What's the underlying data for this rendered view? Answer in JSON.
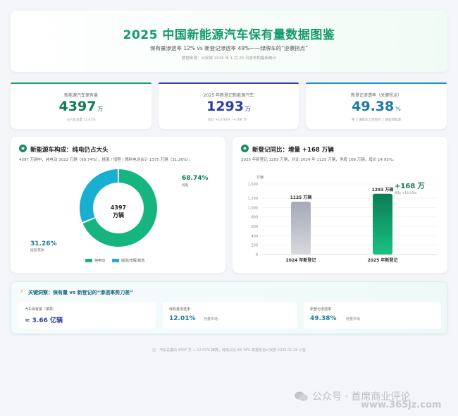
{
  "header": {
    "title": "2025 中国新能源汽车保有量数据图鉴",
    "subtitle": "保有量渗透率 12% vs 新登记渗透率 49%——绿牌车的“逆袭拐点”",
    "source": "数据来源：公安部 2026 年 1 月 26 日发布的最新统计"
  },
  "kpis": [
    {
      "label": "新能源汽车保有量",
      "value": "4397",
      "unit": "万",
      "note": "占汽车总量 12.01%"
    },
    {
      "label": "2025 年新登记新能源汽车",
      "value": "1293",
      "unit": "万",
      "note": "同比 +14.93%（+168 万）"
    },
    {
      "label": "新登记渗透率（关键拐点）",
      "value": "49.38",
      "unit": "%",
      "note": "每 2 辆新车上牌就有 1 辆是新能源"
    }
  ],
  "panel_left": {
    "title": "新能源车构成：纯电仍占大头",
    "desc": "4397 万辆中，纯电动 3022 万辆（68.74%），插混 / 增程 / 燃料电池合计 1375 万辆（31.26%）。",
    "center_line1": "4397",
    "center_line2": "万辆",
    "bev_pct": "68.74%",
    "bev_sub": "纯电",
    "phev_pct": "31.26%",
    "phev_sub": "插混/其他",
    "legend_bev": "纯电动",
    "legend_phev": "插混/增程/其他"
  },
  "panel_right": {
    "title": "新登记同比：增量 +168 万辆",
    "desc": "2025 年新登记 1293 万辆，对比 2024 年 1125 万辆，净增 168 万辆，增长 14.93%。",
    "delta_label": "+168 万",
    "delta_sub": "同比 +14.93%"
  },
  "chart_data": [
    {
      "type": "pie",
      "categories": [
        "纯电动",
        "插混/增程/其他"
      ],
      "values": [
        68.74,
        31.26
      ],
      "colors": [
        "#16b57f",
        "#1aaed0"
      ],
      "total_label": "4397 万辆"
    },
    {
      "type": "bar",
      "categories": [
        "2024 年新登记",
        "2025 年新登记"
      ],
      "values": [
        1125,
        1293
      ],
      "data_labels": [
        "1125 万辆",
        "1293 万辆"
      ],
      "ylabel": "万辆",
      "ylim": [
        0,
        1500
      ],
      "yticks": [
        0,
        200,
        400,
        600,
        800,
        1000,
        1200,
        1500
      ],
      "ytick_labels": [
        "0",
        "200",
        "400",
        "600",
        "800",
        "1,000",
        "1,200",
        "1,500"
      ],
      "colors": [
        "#a9adb8",
        "#0f8f61"
      ],
      "grid": true
    }
  ],
  "insight": {
    "title": "关键洞察：保有量 vs 新登记的“渗透率剪刀差”",
    "items": [
      {
        "label": "汽车保有量（推算）",
        "value": "≈ 3.66 亿辆",
        "extra": ""
      },
      {
        "label": "保有量渗透率",
        "value": "12.01%",
        "extra": "存量市场"
      },
      {
        "label": "新登记渗透率",
        "value": "49.38%",
        "extra": "增量市场"
      }
    ]
  },
  "footnote": "注：汽车总量由 4397 万 ÷ 12.01% 推算；纯电占比 68.74% 数据来自公安部 2026.01.26 公告",
  "watermark": {
    "text": "公众号 · 首席商业评论",
    "url": "www.365jz.com"
  }
}
